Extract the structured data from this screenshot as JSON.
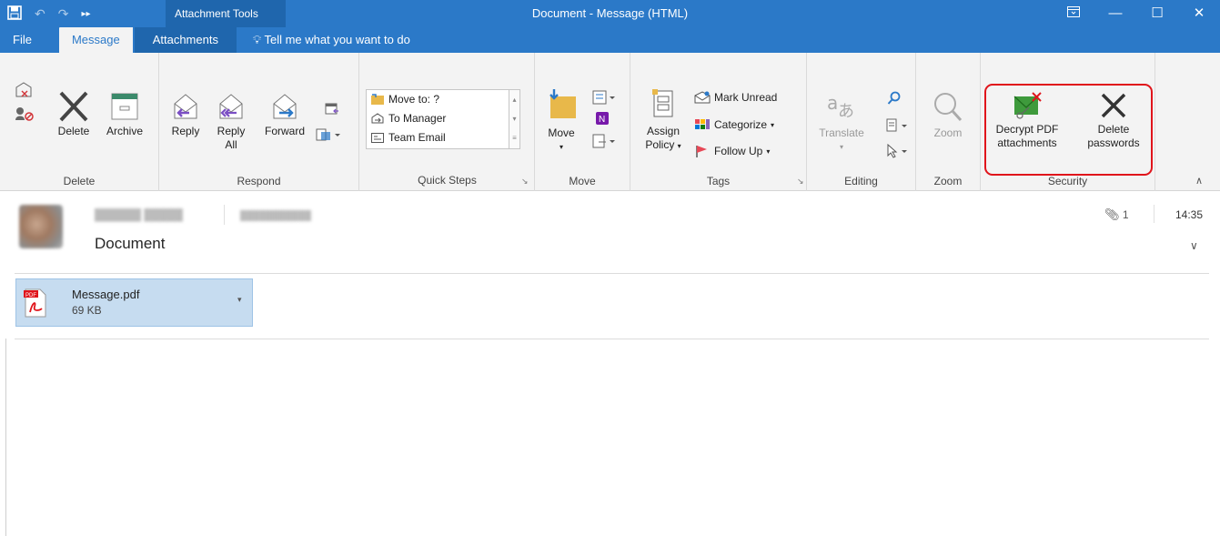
{
  "window": {
    "title": "Document  -  Message (HTML)",
    "context_tools": "Attachment Tools"
  },
  "tabs": [
    {
      "label": "File"
    },
    {
      "label": "Message"
    },
    {
      "label": "Attachments"
    },
    {
      "label": "Tell me what you want to do"
    }
  ],
  "ribbon": {
    "delete_group": {
      "label": "Delete",
      "delete": "Delete",
      "archive": "Archive"
    },
    "respond_group": {
      "label": "Respond",
      "reply": "Reply",
      "reply_all_line1": "Reply",
      "reply_all_line2": "All",
      "forward": "Forward"
    },
    "quick_steps_group": {
      "label": "Quick Steps",
      "items": [
        "Move to: ?",
        "To Manager",
        "Team Email"
      ]
    },
    "move_group": {
      "label": "Move",
      "move": "Move"
    },
    "tags_group": {
      "label": "Tags",
      "assign_line1": "Assign",
      "assign_line2": "Policy",
      "mark_unread": "Mark Unread",
      "categorize": "Categorize",
      "follow_up": "Follow Up"
    },
    "editing_group": {
      "label": "Editing",
      "translate": "Translate"
    },
    "zoom_group": {
      "label": "Zoom",
      "zoom": "Zoom"
    },
    "security_group": {
      "label": "Security",
      "decrypt_line1": "Decrypt PDF",
      "decrypt_line2": "attachments",
      "delete_pw_line1": "Delete",
      "delete_pw_line2": "passwords"
    }
  },
  "message": {
    "subject": "Document",
    "attachment_count": "1",
    "time": "14:35"
  },
  "attachment": {
    "name": "Message.pdf",
    "size": "69 KB"
  },
  "colors": {
    "titlebar": "#2b79c8",
    "ribbon_bg": "#f3f3f3",
    "attachment_bg": "#c6dcf0",
    "highlight_outline": "#e0141b"
  }
}
